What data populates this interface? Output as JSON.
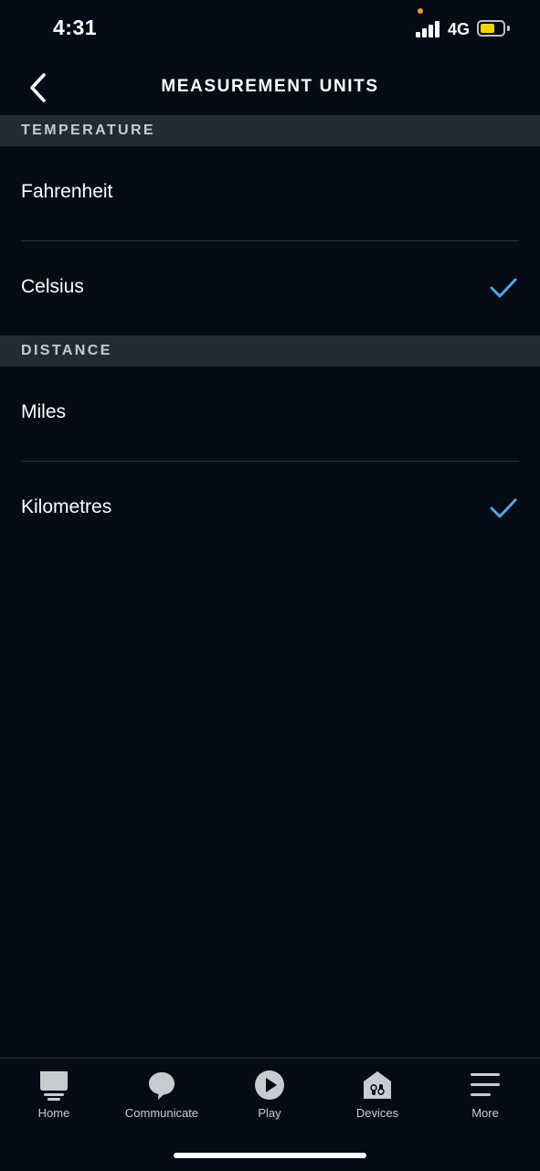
{
  "status_bar": {
    "time": "4:31",
    "network": "4G",
    "signal_icon": "cellular-signal-icon",
    "battery_icon": "battery-icon",
    "battery_color": "#f6d400",
    "privacy_dot_color": "#f09a1e"
  },
  "header": {
    "title": "MEASUREMENT UNITS",
    "back_icon": "chevron-left-icon"
  },
  "sections": {
    "temperature": {
      "title": "TEMPERATURE",
      "options": [
        {
          "label": "Fahrenheit",
          "selected": false
        },
        {
          "label": "Celsius",
          "selected": true
        }
      ]
    },
    "distance": {
      "title": "DISTANCE",
      "options": [
        {
          "label": "Miles",
          "selected": false
        },
        {
          "label": "Kilometres",
          "selected": true
        }
      ]
    }
  },
  "check_color": "#4fa8e8",
  "tabs": [
    {
      "label": "Home",
      "icon": "home-icon"
    },
    {
      "label": "Communicate",
      "icon": "chat-bubble-icon"
    },
    {
      "label": "Play",
      "icon": "play-icon"
    },
    {
      "label": "Devices",
      "icon": "devices-home-icon"
    },
    {
      "label": "More",
      "icon": "menu-icon"
    }
  ]
}
